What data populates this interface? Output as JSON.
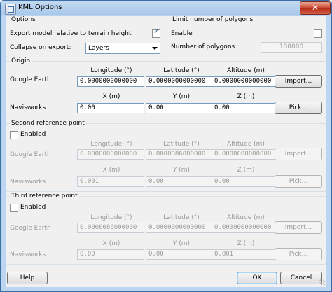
{
  "window": {
    "title": "KML Options",
    "close_label": "✕"
  },
  "options": {
    "title": "Options",
    "export_label": "Export model relative to terrain height",
    "export_checked": true,
    "collapse_label": "Collapse on export:",
    "collapse_value": "Layers"
  },
  "limit": {
    "title": "Limit number of polygons",
    "enable_label": "Enable",
    "enable_checked": false,
    "count_label": "Number of polygons",
    "count_value": "100000"
  },
  "origin": {
    "title": "Origin",
    "ge_label": "Google Earth",
    "nw_label": "Navisworks",
    "lon_header": "Longitude (°)",
    "lat_header": "Latitude (°)",
    "alt_header": "Altitude (m)",
    "x_header": "X (m)",
    "y_header": "Y (m)",
    "z_header": "Z (m)",
    "lon": "0.0000000000000",
    "lat": "0.0000000000000",
    "alt": "0.0000000000000",
    "x": "0.00",
    "y": "0.00",
    "z": "0.00",
    "import_label": "Import...",
    "pick_label": "Pick..."
  },
  "second": {
    "title": "Second reference point",
    "enabled_label": "Enabled",
    "ge_label": "Google Earth",
    "nw_label": "Navisworks",
    "lon_header": "Longitude (°)",
    "lat_header": "Latitude (°)",
    "alt_header": "Altitude (m)",
    "x_header": "X (m)",
    "y_header": "Y (m)",
    "z_header": "Z (m)",
    "lon": "0.0000000000000",
    "lat": "0.0000086000000",
    "alt": "0.0000000000000",
    "x": "0.001",
    "y": "0.00",
    "z": "0.00",
    "import_label": "Import...",
    "pick_label": "Pick..."
  },
  "third": {
    "title": "Third reference point",
    "enabled_label": "Enabled",
    "ge_label": "Google Earth",
    "nw_label": "Navisworks",
    "lon_header": "Longitude (°)",
    "lat_header": "Latitude (°)",
    "alt_header": "Altitude (m)",
    "x_header": "X (m)",
    "y_header": "Y (m)",
    "z_header": "Z (m)",
    "lon": "0.0000086000000",
    "lat": "0.0000000000000",
    "alt": "0.0000000000000",
    "x": "0.00",
    "y": "0.00",
    "z": "0.001",
    "import_label": "Import...",
    "pick_label": "Pick..."
  },
  "footer": {
    "help_label": "Help",
    "ok_label": "OK",
    "cancel_label": "Cancel"
  }
}
